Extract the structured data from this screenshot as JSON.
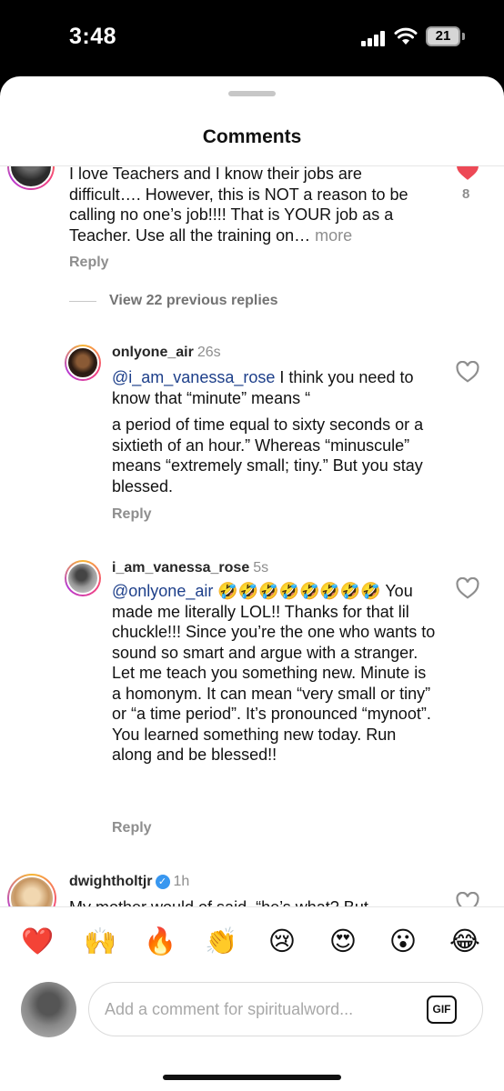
{
  "status_bar": {
    "time": "3:48",
    "battery": "21",
    "icons": [
      "signal-icon",
      "wifi-icon",
      "battery-icon"
    ]
  },
  "sheet": {
    "title": "Comments"
  },
  "comments": {
    "parent": {
      "text": "I love Teachers and I know their jobs are difficult…. However, this is NOT a reason to be calling no one’s job!!!! That is YOUR job as a Teacher. Use all the training on…",
      "more_label": "more",
      "likes": "8",
      "reply_label": "Reply"
    },
    "view_replies_label": "View 22 previous replies",
    "replies": [
      {
        "username": "onlyone_air",
        "time": "26s",
        "mention": "@i_am_vanessa_rose",
        "text_line1": " I think you need to know that “minute” means “",
        "text_line2": "a period of time equal to sixty seconds or a sixtieth of an hour.” Whereas “minuscule” means “extremely small; tiny.” But you stay blessed.",
        "reply_label": "Reply"
      },
      {
        "username": "i_am_vanessa_rose",
        "time": "5s",
        "mention": "@onlyone_air",
        "emojis": " 🤣🤣🤣🤣🤣🤣🤣🤣",
        "text": " You made me literally LOL!! Thanks for that lil chuckle!!! Since you’re the one who wants to sound so smart and argue with a stranger. Let me teach you something new. Minute is a homonym. It can mean “very small or tiny” or “a time period”. It’s pronounced “mynoot”. You learned something new today. Run along and be blessed!!",
        "reply_label": "Reply"
      }
    ],
    "next": {
      "username": "dwightholtjr",
      "time": "1h",
      "text": "My mother would of said, “he’s what? But"
    }
  },
  "emoji_bar": [
    "❤️",
    "🙌",
    "🔥",
    "👏",
    "😢",
    "😍",
    "😮",
    "😂"
  ],
  "composer": {
    "placeholder": "Add a comment for spiritualword...",
    "gif_label": "GIF"
  },
  "colors": {
    "like_red": "#ed4956",
    "mention_blue": "#1d3f8a",
    "secondary_gray": "#8e8e8e"
  }
}
